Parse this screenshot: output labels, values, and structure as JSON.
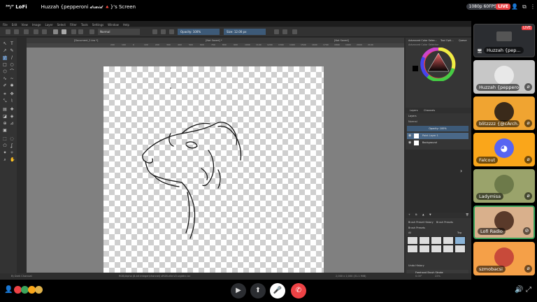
{
  "header": {
    "logo": "³⁴/⁷ LoFi",
    "title": "Huzzah {pepperoni 𝓭𝓻𝓾𝓲𝓭 🔺}'s Screen",
    "quality": "1080p 60FPS",
    "live": "LIVE"
  },
  "krita": {
    "menu": [
      "File",
      "Edit",
      "View",
      "Image",
      "Layer",
      "Select",
      "Filter",
      "Tools",
      "Settings",
      "Window",
      "Help"
    ],
    "blend_mode": "Normal",
    "opacity": "Opacity: 100%",
    "size": "Size: 12.00 px",
    "tabs": [
      "[Document_2.kra *]",
      "[Not Saved] *",
      "[Not Saved]"
    ],
    "ruler_ticks": [
      "200",
      "100",
      "0",
      "100",
      "200",
      "300",
      "400",
      "500",
      "600",
      "700",
      "800",
      "900",
      "1000",
      "1100",
      "1200",
      "1300",
      "1400",
      "1500",
      "1600",
      "1700",
      "1800",
      "1900",
      "2000",
      "2100"
    ],
    "status_left": "B) Dark Charcoal",
    "status_mid": "RGB/Alpha (8-bit integer/channel)  sRGB-elle-V2-srgbtrc.icc",
    "status_right": "2,000 x 2,000 (31.1 MiB)",
    "zoom": "22%",
    "rotation": "0.00°",
    "docker": {
      "color_tab": "Advanced Color Selec...",
      "tool_opts": "Tool Opti...",
      "queue": "Queue",
      "color_title": "Advanced Color Selector",
      "layers_tab": "Layers",
      "channels_tab": "Channels",
      "layers_title": "Layers",
      "blend": "Normal",
      "layer_opacity": "Opacity: 100%",
      "layers": [
        {
          "name": "Paint Layer 1",
          "selected": true
        },
        {
          "name": "Background",
          "selected": false
        }
      ],
      "brush_tab1": "Brush Preset History",
      "brush_tab2": "Brush Presets",
      "brush_title": "Brush Presets",
      "brush_filter": "All",
      "brush_tag": "Tag",
      "undo_title": "Undo History",
      "undo": [
        "Freehand Brush Stroke",
        "Freehand Brush Stroke"
      ]
    }
  },
  "participants": [
    {
      "name": "Huzzah {pep...",
      "bg": "#2b2d31",
      "streaming": true
    },
    {
      "name": "Huzzah {pepperoni...",
      "bg": "#c7c7c7",
      "streaming": false
    },
    {
      "name": "blitzzzz {@cArch...",
      "bg": "#f0a431",
      "streaming": false
    },
    {
      "name": "Falcout",
      "bg": "#faa61a",
      "streaming": false
    },
    {
      "name": "Ladymisa",
      "bg": "#9aa36b",
      "streaming": false
    },
    {
      "name": "Lofi Radio",
      "bg": "#d9b08c",
      "streaming": false
    },
    {
      "name": "szmobacsi",
      "bg": "#f5a048",
      "streaming": false
    }
  ],
  "tile_live": "LIVE",
  "colors": {
    "accent": "#ed4245",
    "brand": "#5865f2",
    "selection": "#3d5a78"
  }
}
